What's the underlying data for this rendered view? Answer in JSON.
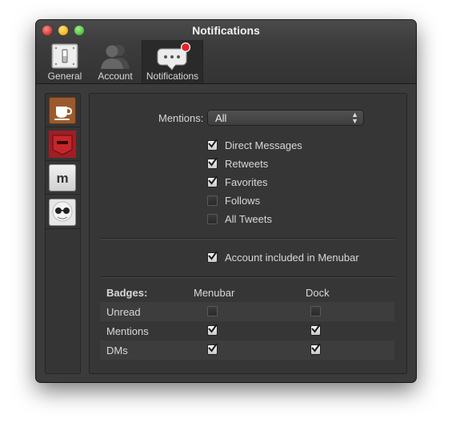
{
  "window": {
    "title": "Notifications"
  },
  "toolbar": {
    "items": [
      {
        "label": "General"
      },
      {
        "label": "Account"
      },
      {
        "label": "Notifications"
      }
    ]
  },
  "mentions": {
    "label": "Mentions:",
    "selected": "All"
  },
  "notify_options": [
    {
      "label": "Direct Messages",
      "checked": true
    },
    {
      "label": "Retweets",
      "checked": true
    },
    {
      "label": "Favorites",
      "checked": true
    },
    {
      "label": "Follows",
      "checked": false
    },
    {
      "label": "All Tweets",
      "checked": false
    }
  ],
  "menubar_option": {
    "label": "Account included in Menubar",
    "checked": true
  },
  "badges": {
    "header": "Badges:",
    "columns": [
      "Menubar",
      "Dock"
    ],
    "rows": [
      {
        "label": "Unread",
        "menubar": false,
        "dock": false
      },
      {
        "label": "Mentions",
        "menubar": true,
        "dock": true
      },
      {
        "label": "DMs",
        "menubar": true,
        "dock": true
      }
    ]
  },
  "colors": {
    "accent_badge": "#e0242a",
    "window_bg": "#3b3b3b"
  },
  "accounts": [
    {
      "icon": "coffee-cup-avatar-icon"
    },
    {
      "icon": "red-banner-avatar-icon"
    },
    {
      "icon": "letter-m-avatar-icon"
    },
    {
      "icon": "sunglasses-face-avatar-icon"
    }
  ]
}
